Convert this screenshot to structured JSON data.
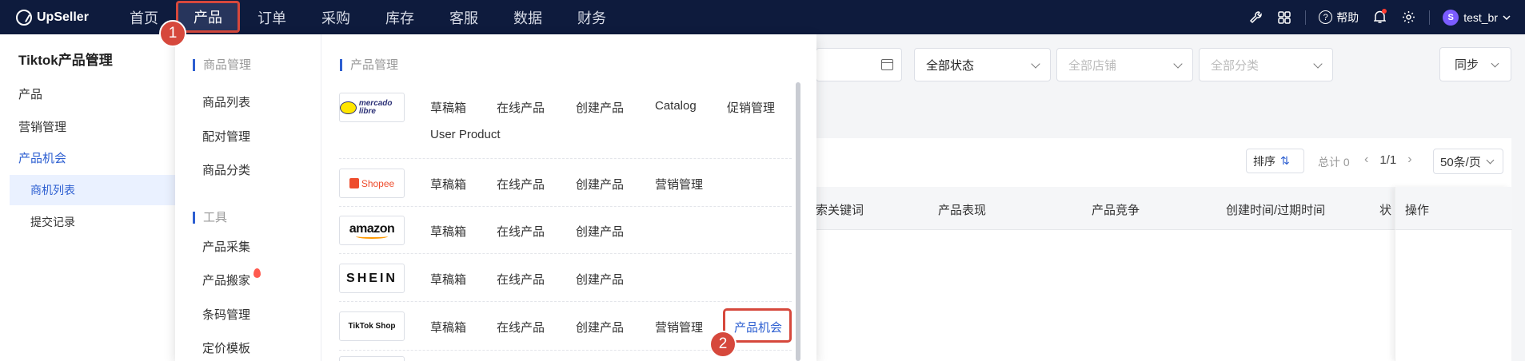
{
  "topnav": {
    "brand": "UpSeller",
    "items": [
      "首页",
      "产品",
      "订单",
      "采购",
      "库存",
      "客服",
      "数据",
      "财务"
    ],
    "active_index": 1,
    "help": "帮助",
    "user": "test_br",
    "avatar_letter": "S"
  },
  "sidebar": {
    "title": "Tiktok产品管理",
    "items": [
      "产品",
      "营销管理",
      "产品机会"
    ],
    "sub_items": [
      "商机列表",
      "提交记录"
    ]
  },
  "filters": {
    "status": "全部状态",
    "shop": "全部店铺",
    "category": "全部分类",
    "sync": "同步"
  },
  "table": {
    "sort_label": "排序",
    "total": "总计 0",
    "page": "1/1",
    "page_size": "50条/页",
    "headers": [
      "索关键词",
      "产品表现",
      "产品竞争",
      "创建时间/过期时间",
      "状"
    ],
    "op_header": "操作"
  },
  "dropdown": {
    "left_sections": [
      {
        "title": "商品管理",
        "items": [
          "商品列表",
          "配对管理",
          "商品分类"
        ]
      },
      {
        "title": "工具",
        "items": [
          "产品采集",
          "产品搬家",
          "条码管理",
          "定价模板"
        ]
      }
    ],
    "right_title": "产品管理",
    "platforms": [
      {
        "logo": "mercado libre",
        "links": [
          "草稿箱",
          "在线产品",
          "创建产品",
          "Catalog",
          "促销管理",
          "User Product"
        ]
      },
      {
        "logo": "Shopee",
        "links": [
          "草稿箱",
          "在线产品",
          "创建产品",
          "营销管理"
        ]
      },
      {
        "logo": "amazon",
        "links": [
          "草稿箱",
          "在线产品",
          "创建产品"
        ]
      },
      {
        "logo": "SHEIN",
        "links": [
          "草稿箱",
          "在线产品",
          "创建产品"
        ]
      },
      {
        "logo": "TikTok Shop",
        "links": [
          "草稿箱",
          "在线产品",
          "创建产品",
          "营销管理",
          "产品机会"
        ]
      }
    ]
  },
  "badges": [
    "1",
    "2"
  ],
  "colors": {
    "nav_bg": "#0e1b3d",
    "accent": "#2d5fd1",
    "highlight": "#d6483c"
  }
}
